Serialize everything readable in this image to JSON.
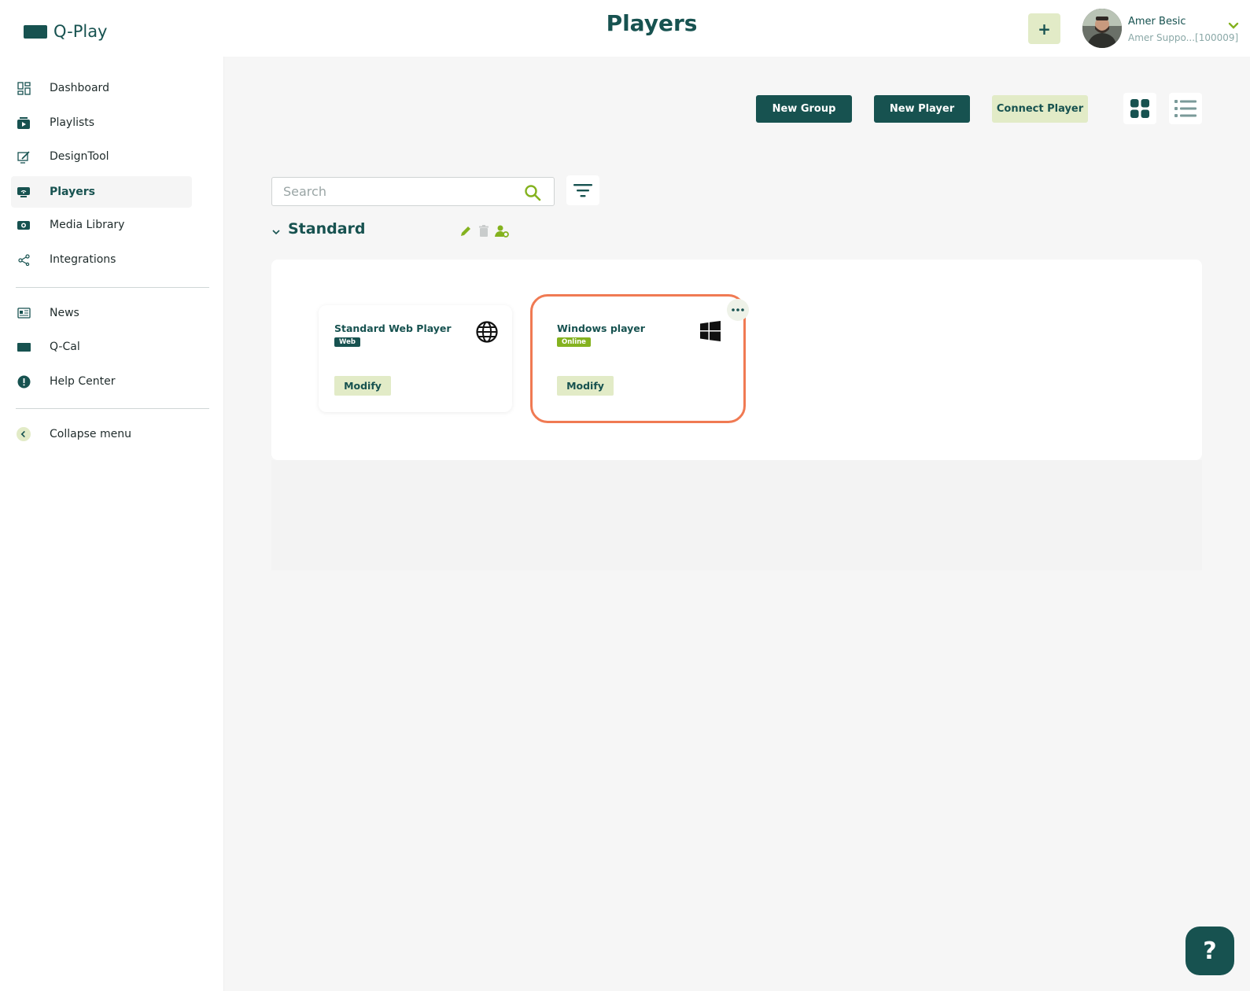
{
  "app": {
    "name": "Q-Play"
  },
  "header": {
    "title": "Players",
    "add_label": "+",
    "user": {
      "name": "Amer Besic",
      "account": "Amer Suppo...[100009]"
    }
  },
  "sidebar": {
    "items": [
      {
        "label": "Dashboard",
        "icon": "dashboard-icon"
      },
      {
        "label": "Playlists",
        "icon": "playlist-icon"
      },
      {
        "label": "DesignTool",
        "icon": "design-icon"
      },
      {
        "label": "Players",
        "icon": "player-icon",
        "active": true
      },
      {
        "label": "Media Library",
        "icon": "media-icon"
      },
      {
        "label": "Integrations",
        "icon": "share-icon"
      },
      {
        "label": "News",
        "icon": "news-icon"
      },
      {
        "label": "Q-Cal",
        "icon": "calendar-icon"
      },
      {
        "label": "Help Center",
        "icon": "help-icon"
      },
      {
        "label": "Collapse menu",
        "icon": "chevron-left-icon"
      }
    ]
  },
  "toolbar": {
    "new_group": "New Group",
    "new_player": "New Player",
    "connect_player": "Connect Player"
  },
  "search": {
    "placeholder": "Search",
    "value": ""
  },
  "group": {
    "name": "Standard",
    "players": [
      {
        "name": "Standard Web Player",
        "badge": "Web",
        "icon": "globe-icon",
        "action": "Modify"
      },
      {
        "name": "Windows player",
        "badge": "Online",
        "icon": "windows-icon",
        "action": "Modify",
        "selected": true
      }
    ]
  },
  "help_fab": "?",
  "colors": {
    "brand": "#175250",
    "accent": "#84b21f",
    "light": "#e2ebc7",
    "selection": "#f07a53"
  }
}
